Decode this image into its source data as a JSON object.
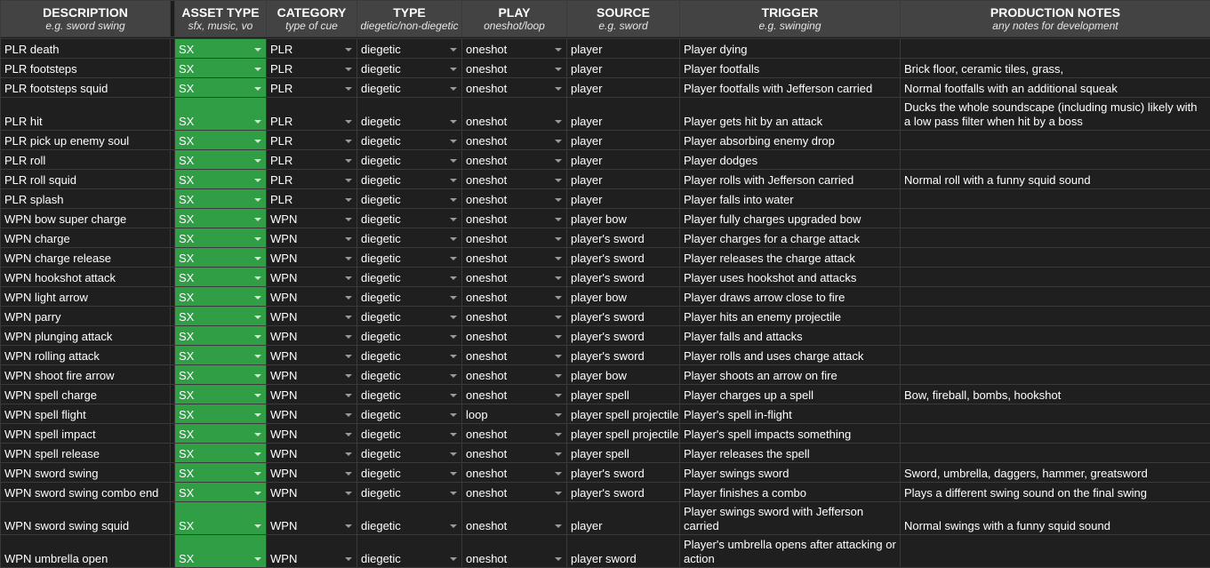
{
  "headers": [
    {
      "title": "DESCRIPTION",
      "sub": "e.g. sword swing"
    },
    {
      "title": "ASSET TYPE",
      "sub": "sfx, music, vo"
    },
    {
      "title": "CATEGORY",
      "sub": "type of cue"
    },
    {
      "title": "TYPE",
      "sub": "diegetic/non-diegetic"
    },
    {
      "title": "PLAY",
      "sub": "oneshot/loop"
    },
    {
      "title": "SOURCE",
      "sub": "e.g. sword"
    },
    {
      "title": "TRIGGER",
      "sub": "e.g. swinging"
    },
    {
      "title": "PRODUCTION NOTES",
      "sub": "any notes for development"
    }
  ],
  "rows": [
    {
      "desc": "PLR death",
      "asset": "SX",
      "cat": "PLR",
      "type": "diegetic",
      "play": "oneshot",
      "source": "player",
      "trigger": "Player dying",
      "notes": ""
    },
    {
      "desc": "PLR footsteps",
      "asset": "SX",
      "cat": "PLR",
      "type": "diegetic",
      "play": "oneshot",
      "source": "player",
      "trigger": "Player footfalls",
      "notes": "Brick floor, ceramic tiles, grass,"
    },
    {
      "desc": "PLR footsteps squid",
      "asset": "SX",
      "cat": "PLR",
      "type": "diegetic",
      "play": "oneshot",
      "source": "player",
      "trigger": "Player footfalls with Jefferson carried",
      "notes": "Normal footfalls with an additional squeak"
    },
    {
      "desc": "PLR hit",
      "asset": "SX",
      "cat": "PLR",
      "type": "diegetic",
      "play": "oneshot",
      "source": "player",
      "trigger": "Player gets hit by an attack",
      "notes": "Ducks the whole soundscape (including music) likely with a low pass filter when hit by a boss",
      "tall": true
    },
    {
      "desc": "PLR pick up enemy soul",
      "asset": "SX",
      "cat": "PLR",
      "type": "diegetic",
      "play": "oneshot",
      "source": "player",
      "trigger": "Player absorbing enemy drop",
      "notes": ""
    },
    {
      "desc": "PLR roll",
      "asset": "SX",
      "cat": "PLR",
      "type": "diegetic",
      "play": "oneshot",
      "source": "player",
      "trigger": "Player dodges",
      "notes": ""
    },
    {
      "desc": "PLR roll squid",
      "asset": "SX",
      "cat": "PLR",
      "type": "diegetic",
      "play": "oneshot",
      "source": "player",
      "trigger": "Player rolls with Jefferson carried",
      "notes": "Normal roll with a funny squid sound"
    },
    {
      "desc": "PLR splash",
      "asset": "SX",
      "cat": "PLR",
      "type": "diegetic",
      "play": "oneshot",
      "source": "player",
      "trigger": "Player falls into water",
      "notes": ""
    },
    {
      "desc": "WPN bow super charge",
      "asset": "SX",
      "cat": "WPN",
      "type": "diegetic",
      "play": "oneshot",
      "source": "player bow",
      "trigger": "Player fully charges upgraded bow",
      "notes": ""
    },
    {
      "desc": "WPN charge",
      "asset": "SX",
      "cat": "WPN",
      "type": "diegetic",
      "play": "oneshot",
      "source": "player's sword",
      "trigger": "Player charges for a charge attack",
      "notes": ""
    },
    {
      "desc": "WPN charge release",
      "asset": "SX",
      "cat": "WPN",
      "type": "diegetic",
      "play": "oneshot",
      "source": "player's sword",
      "trigger": "Player releases the charge attack",
      "notes": ""
    },
    {
      "desc": "WPN hookshot attack",
      "asset": "SX",
      "cat": "WPN",
      "type": "diegetic",
      "play": "oneshot",
      "source": "player's sword",
      "trigger": "Player uses hookshot and attacks",
      "notes": ""
    },
    {
      "desc": "WPN light arrow",
      "asset": "SX",
      "cat": "WPN",
      "type": "diegetic",
      "play": "oneshot",
      "source": "player bow",
      "trigger": "Player draws arrow close to fire",
      "notes": ""
    },
    {
      "desc": "WPN parry",
      "asset": "SX",
      "cat": "WPN",
      "type": "diegetic",
      "play": "oneshot",
      "source": "player's sword",
      "trigger": "Player hits an enemy projectile",
      "notes": ""
    },
    {
      "desc": "WPN plunging attack",
      "asset": "SX",
      "cat": "WPN",
      "type": "diegetic",
      "play": "oneshot",
      "source": "player's sword",
      "trigger": "Player falls and attacks",
      "notes": ""
    },
    {
      "desc": "WPN rolling attack",
      "asset": "SX",
      "cat": "WPN",
      "type": "diegetic",
      "play": "oneshot",
      "source": "player's sword",
      "trigger": "Player rolls and uses charge attack",
      "notes": ""
    },
    {
      "desc": "WPN shoot fire arrow",
      "asset": "SX",
      "cat": "WPN",
      "type": "diegetic",
      "play": "oneshot",
      "source": "player bow",
      "trigger": "Player shoots an arrow on fire",
      "notes": ""
    },
    {
      "desc": "WPN spell charge",
      "asset": "SX",
      "cat": "WPN",
      "type": "diegetic",
      "play": "oneshot",
      "source": "player spell",
      "trigger": "Player charges up a spell",
      "notes": "Bow, fireball, bombs, hookshot"
    },
    {
      "desc": "WPN spell flight",
      "asset": "SX",
      "cat": "WPN",
      "type": "diegetic",
      "play": "loop",
      "source": "player spell projectile",
      "trigger": "Player's spell in-flight",
      "notes": ""
    },
    {
      "desc": "WPN spell impact",
      "asset": "SX",
      "cat": "WPN",
      "type": "diegetic",
      "play": "oneshot",
      "source": "player spell projectile",
      "trigger": "Player's spell impacts something",
      "notes": ""
    },
    {
      "desc": "WPN spell release",
      "asset": "SX",
      "cat": "WPN",
      "type": "diegetic",
      "play": "oneshot",
      "source": "player spell",
      "trigger": "Player releases the spell",
      "notes": ""
    },
    {
      "desc": "WPN sword swing",
      "asset": "SX",
      "cat": "WPN",
      "type": "diegetic",
      "play": "oneshot",
      "source": "player's sword",
      "trigger": "Player swings sword",
      "notes": "Sword, umbrella, daggers, hammer, greatsword"
    },
    {
      "desc": "WPN sword swing combo end",
      "asset": "SX",
      "cat": "WPN",
      "type": "diegetic",
      "play": "oneshot",
      "source": "player's sword",
      "trigger": "Player finishes a combo",
      "notes": "Plays a different swing sound on the final swing"
    },
    {
      "desc": "WPN sword swing squid",
      "asset": "SX",
      "cat": "WPN",
      "type": "diegetic",
      "play": "oneshot",
      "source": "player",
      "trigger": "Player swings sword with Jefferson carried",
      "notes": "Normal swings with a funny squid sound",
      "tall": true
    },
    {
      "desc": "WPN umbrella open",
      "asset": "SX",
      "cat": "WPN",
      "type": "diegetic",
      "play": "oneshot",
      "source": "player sword",
      "trigger": "Player's umbrella opens after attacking or action",
      "notes": "",
      "tall": true
    }
  ]
}
